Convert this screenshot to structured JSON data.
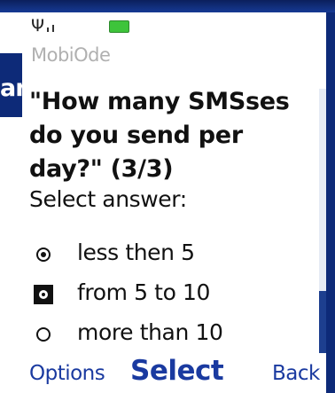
{
  "background_fragment": "an",
  "status_bar": {
    "antenna_icon": "antenna-icon",
    "battery_color": "#3ec43b"
  },
  "app": {
    "title": "MobiOde"
  },
  "question": {
    "text": "\"How many SMSses do you send per day?\" (3/3)"
  },
  "prompt": "Select answer:",
  "options": [
    {
      "label": "less then 5",
      "state": "selected"
    },
    {
      "label": "from 5 to 10",
      "state": "focused"
    },
    {
      "label": "more than 10",
      "state": "unselected"
    }
  ],
  "softkeys": {
    "left": "Options",
    "center": "Select",
    "right": "Back"
  },
  "colors": {
    "softkey_text": "#1a3aa0",
    "frame": "#0e2c7a",
    "scroll_thumb": "#1d3f8f"
  }
}
